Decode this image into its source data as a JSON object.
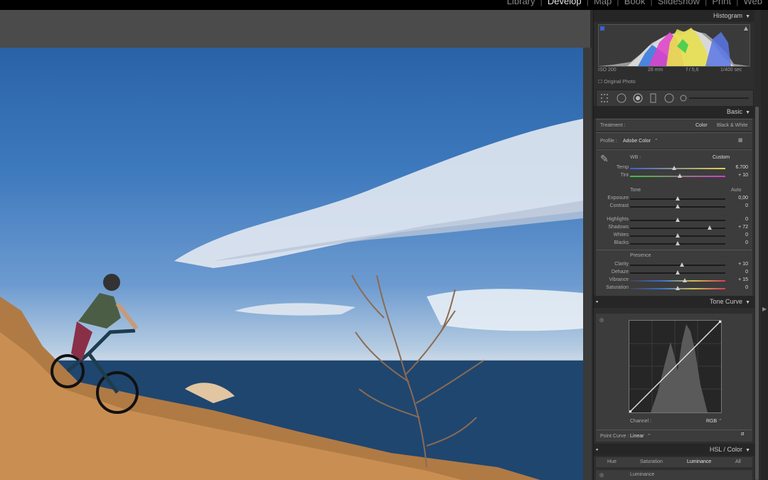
{
  "modules": {
    "items": [
      "Library",
      "Develop",
      "Map",
      "Book",
      "Slideshow",
      "Print",
      "Web"
    ],
    "active": "Develop"
  },
  "histogram": {
    "title": "Histogram",
    "iso": "ISO 200",
    "focal": "28 mm",
    "aperture": "f / 5,6",
    "shutter": "1/400 sec",
    "original_photo": "Original Photo"
  },
  "basic": {
    "title": "Basic",
    "treatment_label": "Treatment :",
    "treatment_color": "Color",
    "treatment_bw": "Black & White",
    "profile_label": "Profile :",
    "profile_value": "Adobe Color",
    "wb_label": "WB :",
    "wb_value": "Custom",
    "temp_label": "Temp",
    "temp_value": "6.700",
    "tint_label": "Tint",
    "tint_value": "+ 10",
    "tone_label": "Tone",
    "auto_label": "Auto",
    "exposure_label": "Exposure",
    "exposure_value": "0,00",
    "contrast_label": "Contrast",
    "contrast_value": "0",
    "highlights_label": "Highlights",
    "highlights_value": "0",
    "shadows_label": "Shadows",
    "shadows_value": "+ 72",
    "whites_label": "Whites",
    "whites_value": "0",
    "blacks_label": "Blacks",
    "blacks_value": "0",
    "presence_label": "Presence",
    "clarity_label": "Clarity",
    "clarity_value": "+ 10",
    "dehaze_label": "Dehaze",
    "dehaze_value": "0",
    "vibrance_label": "Vibrance",
    "vibrance_value": "+ 15",
    "saturation_label": "Saturation",
    "saturation_value": "0"
  },
  "tone_curve": {
    "title": "Tone Curve",
    "channel_label": "Channel :",
    "channel_value": "RGB",
    "point_curve_label": "Point Curve :",
    "point_curve_value": "Linear"
  },
  "hsl": {
    "title": "HSL / Color",
    "tabs": [
      "Hue",
      "Saturation",
      "Luminance",
      "All"
    ],
    "active_tab": "Luminance",
    "section_label": "Luminance"
  }
}
